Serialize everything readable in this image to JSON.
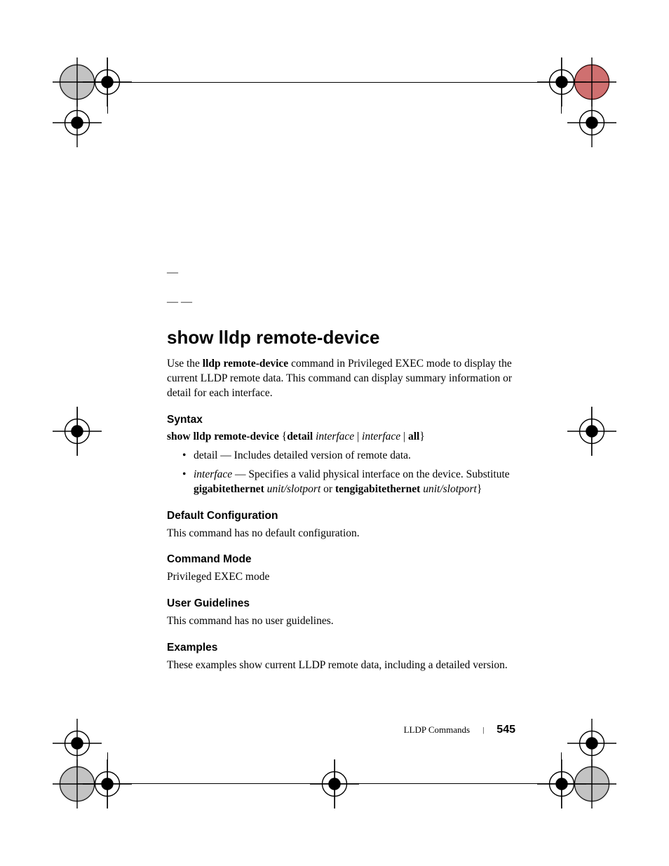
{
  "orphan1": "—",
  "orphan2": "— —",
  "title": "show lldp remote-device",
  "intro_pre": "Use the ",
  "intro_bold": "lldp remote-device",
  "intro_post": " command in Privileged EXEC mode to display the current LLDP remote data. This command can display summary information or detail for each interface.",
  "syntax_heading": "Syntax",
  "syntax_bold": "show lldp remote-device",
  "syntax_open": " {",
  "syntax_detail": "detail",
  "syntax_sp1": " ",
  "syntax_if1": "interface",
  "syntax_pipe1": " | ",
  "syntax_if2": "interface",
  "syntax_pipe2": " | ",
  "syntax_all": "all",
  "syntax_close": "}",
  "bullet1": "detail — Includes detailed version of remote data.",
  "bullet2_italic": "interface",
  "bullet2_rest": " — Specifies a valid physical interface on the device. Substitute ",
  "bullet2_bold1": "gigabitethernet",
  "bullet2_sp1": " ",
  "bullet2_it1": "unit/slotport",
  "bullet2_or": " or ",
  "bullet2_bold2": "tengigabitethernet",
  "bullet2_sp2": " ",
  "bullet2_it2": "unit/slotport",
  "bullet2_end": "}",
  "defconf_heading": "Default Configuration",
  "defconf_body": "This command has no default configuration.",
  "cmdmode_heading": "Command Mode",
  "cmdmode_body": "Privileged EXEC mode",
  "userguide_heading": "User Guidelines",
  "userguide_body": "This command has no user guidelines.",
  "examples_heading": "Examples",
  "examples_body": "These examples show current LLDP remote data, including a detailed version.",
  "footer_section": "LLDP Commands",
  "footer_page": "545"
}
